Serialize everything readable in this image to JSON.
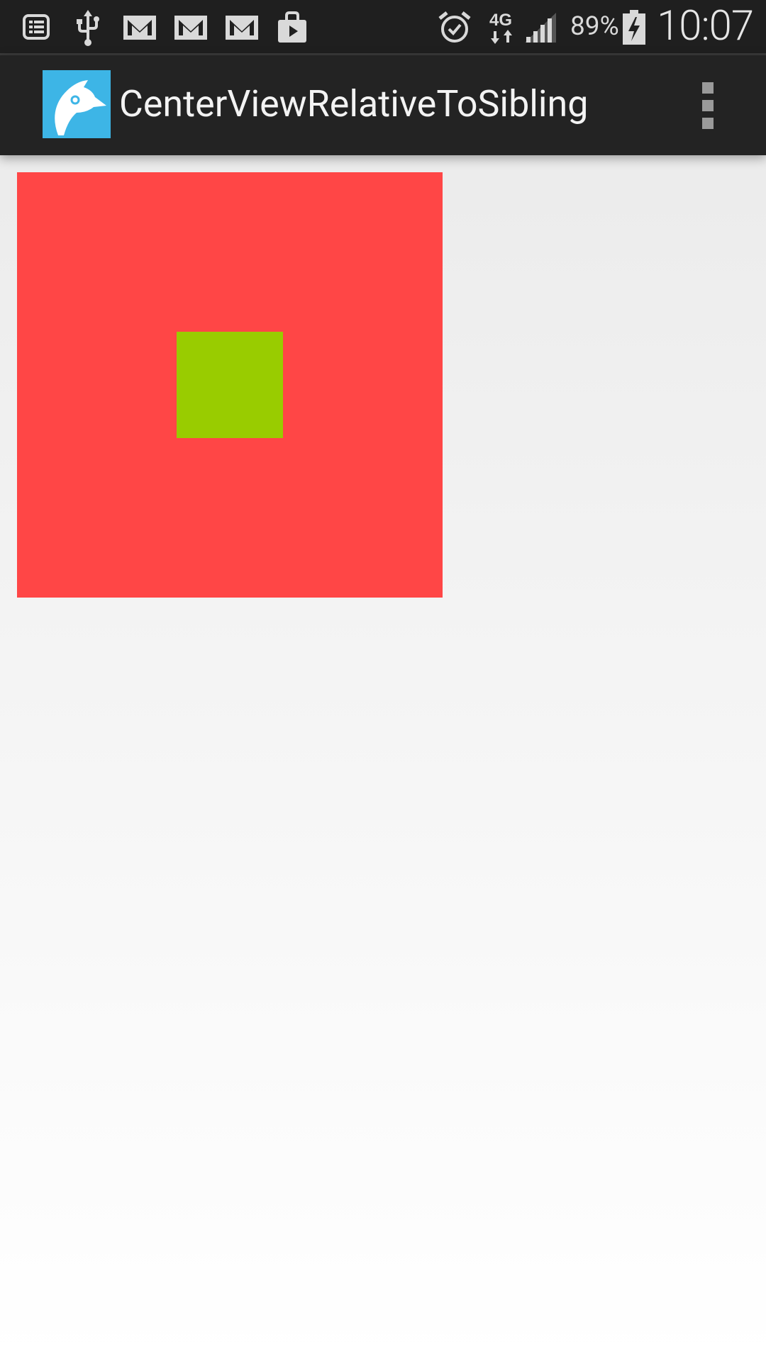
{
  "status_bar": {
    "icons": [
      "task-list-icon",
      "usb-icon",
      "gmail-icon",
      "gmail-icon",
      "gmail-icon",
      "briefcase-icon",
      "alarm-icon",
      "4g-data-icon",
      "signal-icon",
      "battery-charging-icon"
    ],
    "network_label": "4G",
    "battery_percent": "89%",
    "clock": "10:07"
  },
  "action_bar": {
    "app_icon": "bird-app-icon",
    "title": "CenterViewRelativeToSibling",
    "overflow_icon": "overflow-menu-icon"
  },
  "content": {
    "parent_view_color": "#ff4646",
    "child_view_color": "#99cc00"
  },
  "colors": {
    "status_bar_bg": "#1f1f1f",
    "action_bar_bg": "#232323",
    "app_icon_bg": "#3db5e6"
  }
}
